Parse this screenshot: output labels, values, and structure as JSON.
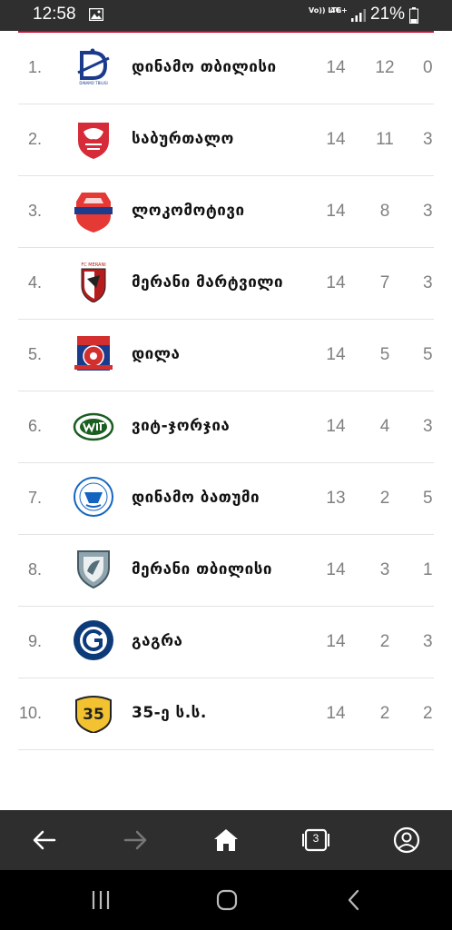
{
  "status_bar": {
    "time": "12:58",
    "volte": "Vo)) LTE",
    "network": "4G+",
    "battery_percent": "21%"
  },
  "standings": [
    {
      "rank": "1.",
      "team": "დინამო თბილისი",
      "played": "14",
      "wins": "12",
      "draws": "0",
      "logo": "dinamo-tbilisi-logo"
    },
    {
      "rank": "2.",
      "team": "საბურთალო",
      "played": "14",
      "wins": "11",
      "draws": "3",
      "logo": "saburtalo-logo"
    },
    {
      "rank": "3.",
      "team": "ლოკომოტივი",
      "played": "14",
      "wins": "8",
      "draws": "3",
      "logo": "lokomotivi-logo"
    },
    {
      "rank": "4.",
      "team": "მერანი მარტვილი",
      "played": "14",
      "wins": "7",
      "draws": "3",
      "logo": "merani-martvili-logo"
    },
    {
      "rank": "5.",
      "team": "დილა",
      "played": "14",
      "wins": "5",
      "draws": "5",
      "logo": "dila-logo"
    },
    {
      "rank": "6.",
      "team": "ვიტ-ჯორჯია",
      "played": "14",
      "wins": "4",
      "draws": "3",
      "logo": "wit-georgia-logo"
    },
    {
      "rank": "7.",
      "team": "დინამო ბათუმი",
      "played": "13",
      "wins": "2",
      "draws": "5",
      "logo": "dinamo-batumi-logo"
    },
    {
      "rank": "8.",
      "team": "მერანი თბილისი",
      "played": "14",
      "wins": "3",
      "draws": "1",
      "logo": "merani-tbilisi-logo"
    },
    {
      "rank": "9.",
      "team": "გაგრა",
      "played": "14",
      "wins": "2",
      "draws": "3",
      "logo": "gagra-logo"
    },
    {
      "rank": "10.",
      "team": "35-ე ს.ს.",
      "played": "14",
      "wins": "2",
      "draws": "2",
      "logo": "35-school-logo"
    }
  ],
  "logo_text": {
    "dinamo_tbilisi": "DINAMO TBILISI",
    "merani_martvili": "FC MERANI",
    "thirty_five": "35"
  },
  "browser_nav": {
    "tabs_count": "3",
    "icons": [
      "back-arrow-icon",
      "forward-arrow-icon",
      "home-icon",
      "tabs-icon",
      "account-icon"
    ]
  },
  "system_nav": {
    "icons": [
      "recent-apps-icon",
      "home-circle-icon",
      "back-chevron-icon"
    ]
  },
  "colors": {
    "accent_rule": "#c8102e",
    "status_bar": "#2f2f2f",
    "browser_bar": "#2e2e2e",
    "system_bar": "#000000"
  }
}
